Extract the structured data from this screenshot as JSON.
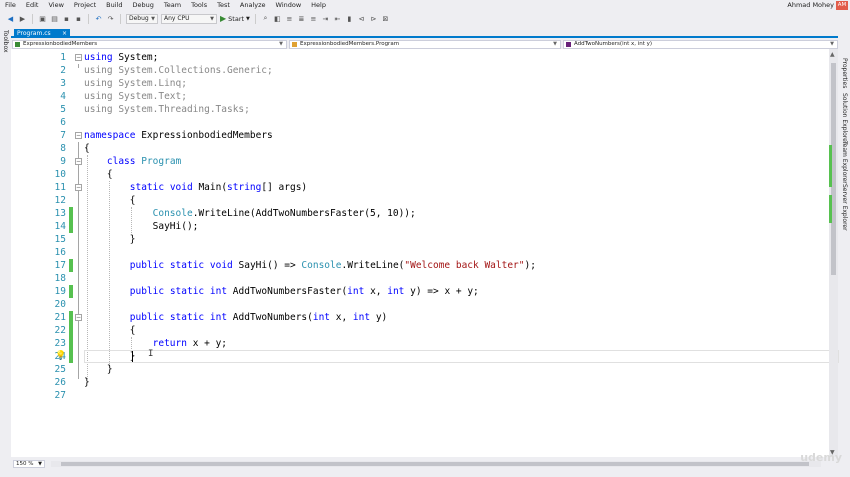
{
  "menu": {
    "items": [
      "File",
      "Edit",
      "View",
      "Project",
      "Build",
      "Debug",
      "Team",
      "Tools",
      "Test",
      "Analyze",
      "Window",
      "Help"
    ],
    "user": "Ahmad Mohey",
    "avatar": "AM"
  },
  "toolbar": {
    "config": "Debug",
    "platform": "Any CPU",
    "start_label": "Start"
  },
  "side_panels": {
    "left": "Toolbox",
    "right": [
      "Properties",
      "Solution Explorer",
      "Team Explorer",
      "Server Explorer"
    ]
  },
  "tab": {
    "label": "Program.cs",
    "close": "×"
  },
  "nav": {
    "project": "ExpressionbodiedMembers",
    "class": "ExpressionbodiedMembers.Program",
    "member": "AddTwoNumbers(int x, int y)"
  },
  "editor": {
    "lines": [
      {
        "n": "1",
        "html": "<span class=\"kw\">using</span> System;"
      },
      {
        "n": "2",
        "html": "<span class=\"dim\">using System.Collections.Generic;</span>"
      },
      {
        "n": "3",
        "html": "<span class=\"dim\">using System.Linq;</span>"
      },
      {
        "n": "4",
        "html": "<span class=\"dim\">using System.Text;</span>"
      },
      {
        "n": "5",
        "html": "<span class=\"dim\">using System.Threading.Tasks;</span>"
      },
      {
        "n": "6",
        "html": ""
      },
      {
        "n": "7",
        "html": "<span class=\"kw\">namespace</span> ExpressionbodiedMembers"
      },
      {
        "n": "8",
        "html": "{"
      },
      {
        "n": "9",
        "html": "    <span class=\"kw\">class</span> <span class=\"ty\">Program</span>"
      },
      {
        "n": "10",
        "html": "    {"
      },
      {
        "n": "11",
        "html": "        <span class=\"kw\">static</span> <span class=\"kw\">void</span> Main(<span class=\"kw\">string</span>[] args)"
      },
      {
        "n": "12",
        "html": "        {"
      },
      {
        "n": "13",
        "html": "            <span class=\"ty\">Console</span>.WriteLine(AddTwoNumbersFaster(5, 10));"
      },
      {
        "n": "14",
        "html": "            SayHi();"
      },
      {
        "n": "15",
        "html": "        }"
      },
      {
        "n": "16",
        "html": ""
      },
      {
        "n": "17",
        "html": "        <span class=\"kw\">public</span> <span class=\"kw\">static</span> <span class=\"kw\">void</span> SayHi() =&gt; <span class=\"ty\">Console</span>.WriteLine(<span class=\"str\">\"Welcome back Walter\"</span>);"
      },
      {
        "n": "18",
        "html": ""
      },
      {
        "n": "19",
        "html": "        <span class=\"kw\">public</span> <span class=\"kw\">static</span> <span class=\"kw\">int</span> AddTwoNumbersFaster(<span class=\"kw\">int</span> x, <span class=\"kw\">int</span> y) =&gt; x + y;"
      },
      {
        "n": "20",
        "html": ""
      },
      {
        "n": "21",
        "html": "        <span class=\"kw\">public</span> <span class=\"kw\">static</span> <span class=\"kw\">int</span> AddTwoNumbers(<span class=\"kw\">int</span> x, <span class=\"kw\">int</span> y)"
      },
      {
        "n": "22",
        "html": "        {"
      },
      {
        "n": "23",
        "html": "            <span class=\"kw\">return</span> x + y;"
      },
      {
        "n": "24",
        "html": "        }"
      },
      {
        "n": "25",
        "html": "    }"
      },
      {
        "n": "26",
        "html": "}"
      },
      {
        "n": "27",
        "html": ""
      }
    ]
  },
  "zoom": "150 %",
  "watermark": "udemy",
  "colors": {
    "accent": "#007acc",
    "keyword": "#0000ff",
    "type": "#2b91af",
    "string": "#a31515",
    "change_marker": "#57c150"
  }
}
